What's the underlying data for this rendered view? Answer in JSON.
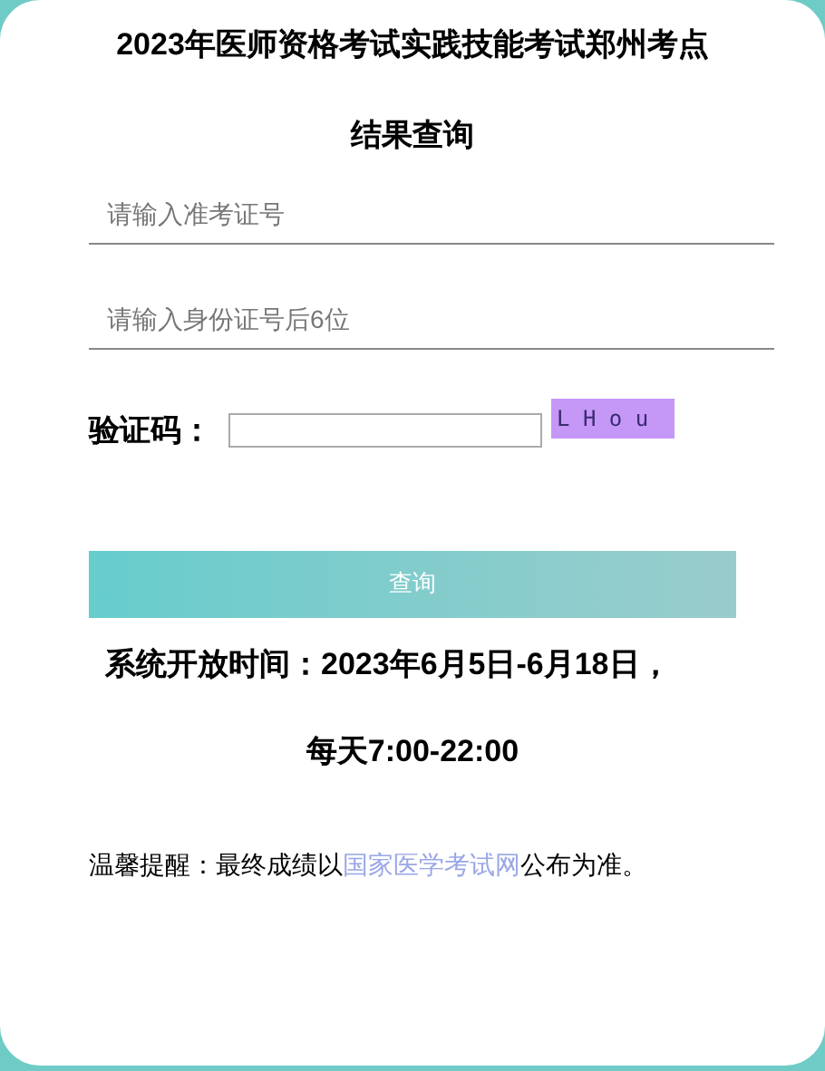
{
  "title": "2023年医师资格考试实践技能考试郑州考点",
  "subtitle": "结果查询",
  "fields": [
    {
      "placeholder": "请输入准考证号"
    },
    {
      "placeholder": "请输入身份证号后6位"
    }
  ],
  "captcha": {
    "label": "验证码：",
    "code": "L H o u"
  },
  "button": "查询",
  "hours": [
    "系统开放时间：2023年6月5日-6月18日，",
    "每天7:00-22:00"
  ],
  "notice": {
    "before": "温馨提醒：最终成绩以",
    "link": "国家医学考试网",
    "after": "公布为准。"
  }
}
